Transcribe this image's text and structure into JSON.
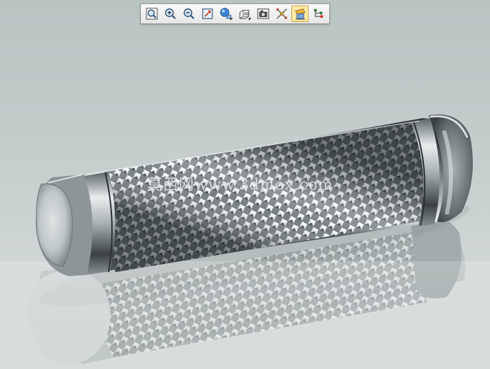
{
  "toolbar": {
    "buttons": [
      {
        "name": "zoom-fit",
        "icon": "zoom-fit-icon",
        "active": false
      },
      {
        "name": "zoom-in",
        "icon": "zoom-in-icon",
        "active": false
      },
      {
        "name": "zoom-out",
        "icon": "zoom-out-icon",
        "active": false
      },
      {
        "name": "normal-view",
        "icon": "normal-view-icon",
        "active": false
      },
      {
        "name": "render-style",
        "icon": "render-style-icon",
        "active": false,
        "flyout": true
      },
      {
        "name": "view-orientation",
        "icon": "view-orientation-icon",
        "active": false,
        "flyout": true
      },
      {
        "name": "capture-image",
        "icon": "camera-icon",
        "active": false
      },
      {
        "name": "explode",
        "icon": "explode-icon",
        "active": false
      },
      {
        "name": "sectioning",
        "icon": "sectioning-icon",
        "active": true
      },
      {
        "name": "structure-tree",
        "icon": "tree-icon",
        "active": false
      }
    ]
  },
  "watermark": {
    "text": "莫西网www.3dmox.com"
  },
  "scene": {
    "object": "knurled-shaft",
    "colors": {
      "metal_dark": "#3f4548",
      "metal_light": "#f4f6f6",
      "background": "#c3cccb"
    }
  }
}
